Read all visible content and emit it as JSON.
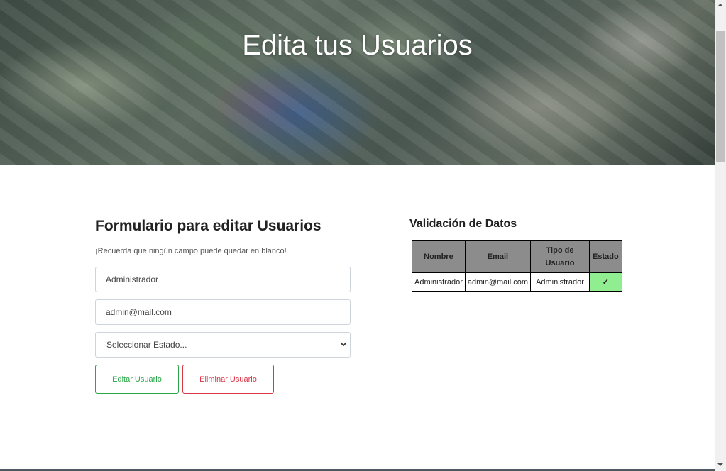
{
  "hero": {
    "title": "Edita tus Usuarios"
  },
  "form": {
    "title": "Formulario para editar Usuarios",
    "hint": "¡Recuerda que ningún campo puede quedar en blanco!",
    "name_value": "Administrador",
    "email_value": "admin@mail.com",
    "status_selected": "Seleccionar Estado...",
    "edit_button": "Editar Usuario",
    "delete_button": "Eliminar Usuario"
  },
  "validation": {
    "title": "Validación de Datos",
    "headers": {
      "nombre": "Nombre",
      "email": "Email",
      "tipo": "Tipo de Usuario",
      "estado": "Estado"
    },
    "row": {
      "nombre": "Administrador",
      "email": "admin@mail.com",
      "tipo": "Administrador",
      "estado": "✓"
    },
    "estado_color": "#90ee90"
  },
  "colors": {
    "edit_accent": "#28a745",
    "delete_accent": "#dc3545",
    "header_bg": "#8c8c8c"
  },
  "icons": {
    "select": "chevron-down-icon",
    "scroll_up": "arrow-up-icon",
    "scroll_down": "arrow-down-icon"
  }
}
